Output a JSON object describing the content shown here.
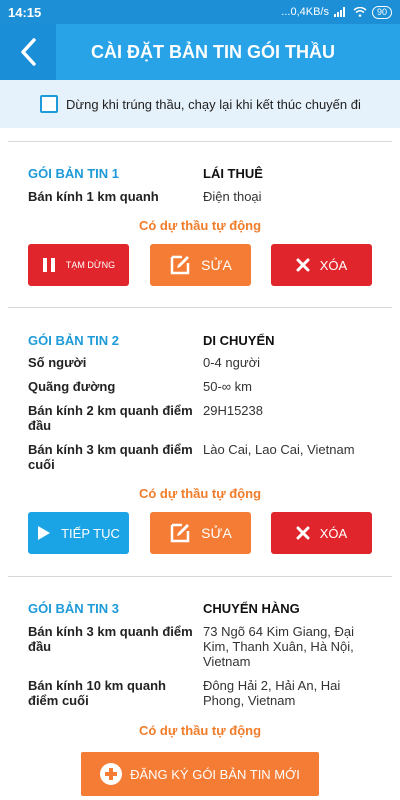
{
  "status_bar": {
    "time": "14:15",
    "net": "...0,4KB/s",
    "battery": "90"
  },
  "header": {
    "title": "CÀI ĐẶT BẢN TIN GÓI THẦU"
  },
  "stop_option": {
    "label": "Dừng khi trúng thầu, chạy lại khi kết thúc chuyến đi",
    "checked": false
  },
  "packages": [
    {
      "name": "GÓI BẢN TIN 1",
      "service": "LÁI THUÊ",
      "rows": [
        {
          "label": "Bán kính 1 km quanh",
          "value": "Điện thoại"
        }
      ],
      "auto_bid": "Có dự thầu tự động",
      "actions": {
        "primary": "TẠM DỪNG",
        "edit": "SỬA",
        "delete": "XÓA"
      }
    },
    {
      "name": "GÓI BẢN TIN 2",
      "service": "DI CHUYỂN",
      "rows": [
        {
          "label": "Số người",
          "value": "0-4 người"
        },
        {
          "label": "Quãng đường",
          "value": "50-∞ km"
        },
        {
          "label": "Bán kính 2 km quanh điểm đầu",
          "value": "29H15238"
        },
        {
          "label": "Bán kính 3 km quanh điểm cuối",
          "value": "Lào Cai, Lao Cai, Vietnam"
        }
      ],
      "auto_bid": "Có dự thầu tự động",
      "actions": {
        "primary": "TIẾP TỤC",
        "edit": "SỬA",
        "delete": "XÓA"
      }
    },
    {
      "name": "GÓI BẢN TIN 3",
      "service": "CHUYỂN HÀNG",
      "rows": [
        {
          "label": "Bán kính 3 km quanh điểm đầu",
          "value": "73 Ngõ 64 Kim Giang, Đại Kim, Thanh Xuân, Hà Nội, Vietnam"
        },
        {
          "label": "Bán kính 10 km quanh điểm cuối",
          "value": "Đông Hải 2, Hải An, Hai Phong, Vietnam"
        }
      ],
      "auto_bid": "Có dự thầu tự động"
    }
  ],
  "register_button": {
    "label": "ĐĂNG KÝ GÓI BẢN TIN MỚI"
  },
  "colors": {
    "header": "#29a3e8",
    "accent_orange": "#f47c34",
    "danger_red": "#e0262c",
    "resume_blue": "#1aa3e5"
  }
}
